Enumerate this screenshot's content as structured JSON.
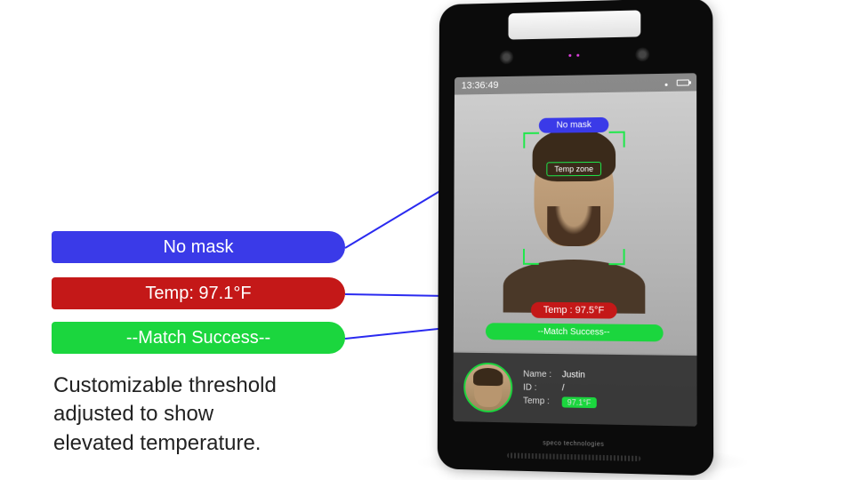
{
  "labels": {
    "nomask": "No mask",
    "temp": "Temp: 97.1°F",
    "match": "--Match Success--"
  },
  "caption": {
    "line1": "Customizable threshold",
    "line2": "adjusted to show",
    "line3": "elevated temperature."
  },
  "device": {
    "brand": "speco technologies",
    "statusbar": {
      "time": "13:36:49"
    },
    "badges": {
      "nomask": "No mask",
      "tempzone": "Temp zone",
      "temp": "Temp : 97.5°F",
      "match": "--Match Success--"
    },
    "info": {
      "name_label": "Name :",
      "name_value": "Justin",
      "id_label": "ID :",
      "id_value": "/",
      "temp_label": "Temp :",
      "temp_value": "97.1°F"
    }
  }
}
